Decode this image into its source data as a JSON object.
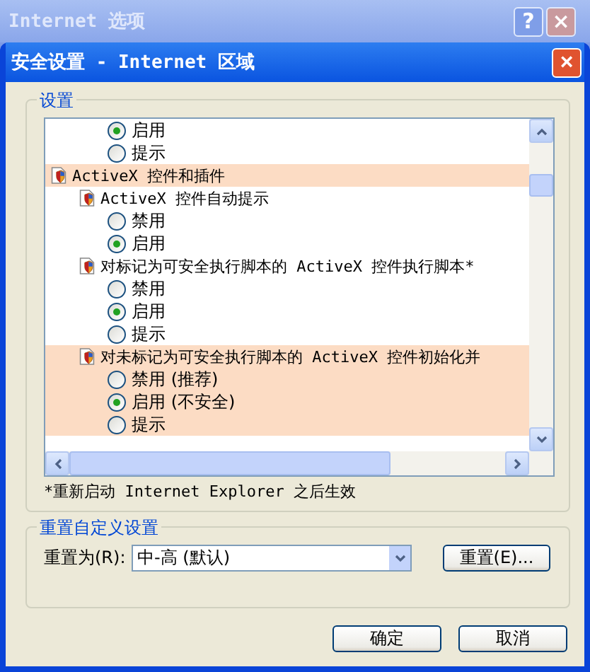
{
  "back_window": {
    "title": "Internet 选项",
    "buttons": [
      "?",
      "×"
    ]
  },
  "dialog": {
    "title": "安全设置 - Internet 区域",
    "close": "×"
  },
  "settings_group": {
    "legend": "设置",
    "top_options": [
      {
        "label": "启用",
        "selected": true,
        "highlighted": false
      },
      {
        "label": "提示",
        "selected": false,
        "highlighted": false
      }
    ],
    "tree": [
      {
        "kind": "category",
        "label": "ActiveX 控件和插件",
        "highlighted": true,
        "children": [
          {
            "kind": "setting",
            "label": "ActiveX 控件自动提示",
            "highlighted": false,
            "children": [
              {
                "kind": "radio",
                "label": "禁用",
                "selected": false,
                "highlighted": false
              },
              {
                "kind": "radio",
                "label": "启用",
                "selected": true,
                "highlighted": false
              }
            ]
          },
          {
            "kind": "setting",
            "label": "对标记为可安全执行脚本的 ActiveX 控件执行脚本*",
            "highlighted": false,
            "children": [
              {
                "kind": "radio",
                "label": "禁用",
                "selected": false,
                "highlighted": false
              },
              {
                "kind": "radio",
                "label": "启用",
                "selected": true,
                "highlighted": false
              },
              {
                "kind": "radio",
                "label": "提示",
                "selected": false,
                "highlighted": false
              }
            ]
          },
          {
            "kind": "setting",
            "label": "对未标记为可安全执行脚本的 ActiveX 控件初始化并",
            "highlighted": true,
            "children": [
              {
                "kind": "radio",
                "label": "禁用 (推荐)",
                "selected": false,
                "highlighted": true
              },
              {
                "kind": "radio",
                "label": "启用 (不安全)",
                "selected": true,
                "highlighted": true
              },
              {
                "kind": "radio",
                "label": "提示",
                "selected": false,
                "highlighted": true
              }
            ]
          }
        ]
      }
    ],
    "note": "*重新启动 Internet Explorer 之后生效"
  },
  "reset_group": {
    "legend": "重置自定义设置",
    "label": "重置为(R):",
    "value": "中-高 (默认)",
    "button": "重置(E)..."
  },
  "buttons": [
    "确定",
    "取消"
  ]
}
